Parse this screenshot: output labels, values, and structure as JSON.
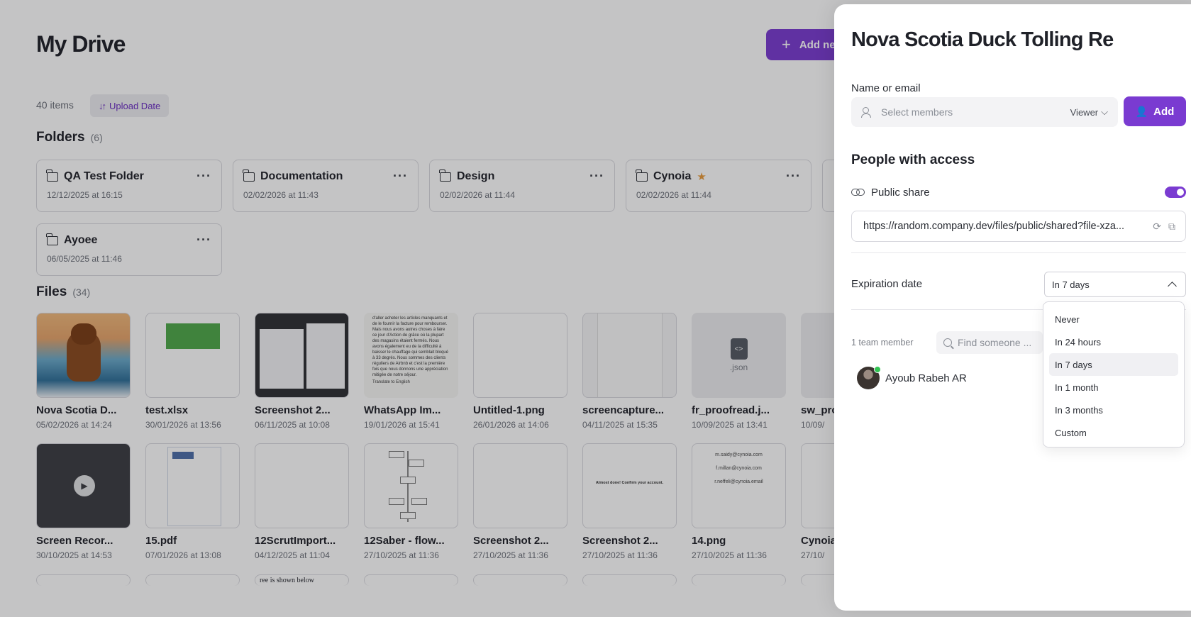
{
  "drive": {
    "title": "My Drive",
    "add_new_label": "Add ne",
    "items_count": "40 items",
    "sort_label": "Upload Date",
    "folders_title": "Folders",
    "folders_count": "(6)",
    "files_title": "Files",
    "files_count": "(34)",
    "folders": [
      {
        "name": "QA Test Folder",
        "date": "12/12/2025 at 16:15",
        "starred": false
      },
      {
        "name": "Documentation",
        "date": "02/02/2026 at 11:43",
        "starred": false
      },
      {
        "name": "Design",
        "date": "02/02/2026 at 11:44",
        "starred": false
      },
      {
        "name": "Cynoia",
        "date": "02/02/2026 at 11:44",
        "starred": true
      },
      {
        "name": "Ayoee",
        "date": "06/05/2025 at 11:46",
        "starred": false
      }
    ],
    "files_row1": [
      {
        "name": "Nova Scotia D...",
        "date": "05/02/2026 at 14:24"
      },
      {
        "name": "test.xlsx",
        "date": "30/01/2026 at 13:56"
      },
      {
        "name": "Screenshot 2...",
        "date": "06/11/2025 at 10:08"
      },
      {
        "name": "WhatsApp Im...",
        "date": "19/01/2026 at 15:41"
      },
      {
        "name": "Untitled-1.png",
        "date": "26/01/2026 at 14:06"
      },
      {
        "name": "screencapture...",
        "date": "04/11/2025 at 15:35"
      },
      {
        "name": "fr_proofread.j...",
        "date": "10/09/2025 at 13:41"
      },
      {
        "name": "sw_pro",
        "date": "10/09/"
      }
    ],
    "files_row2": [
      {
        "name": "Screen Recor...",
        "date": "30/10/2025 at 14:53"
      },
      {
        "name": "15.pdf",
        "date": "07/01/2026 at 13:08"
      },
      {
        "name": "12ScrutImport...",
        "date": "04/12/2025 at 11:04"
      },
      {
        "name": "12Saber - flow...",
        "date": "27/10/2025 at 11:36"
      },
      {
        "name": "Screenshot 2...",
        "date": "27/10/2025 at 11:36"
      },
      {
        "name": "Screenshot 2...",
        "date": "27/10/2025 at 11:36"
      },
      {
        "name": "14.png",
        "date": "27/10/2025 at 11:36"
      },
      {
        "name": "Cynoia",
        "date": "27/10/"
      }
    ],
    "json_label": ".json",
    "whatsapp_text": "d'aller acheter les articles manquants et de le fournir la facture pour rembourser. Mais nous avons autres choses à faire ce jour d'Action de grâce où la plupart des magasins étaient fermés. Nous avons également eu de la difficulté à baisser le chauffage qui semblait bloqué à 33 degrés. Nous sommes des clients réguliers de Airbnb et c'est la première fois que nous donnons une appréciation mitigée de notre séjour.",
    "whatsapp_footer": "Translate to English",
    "emails": [
      "m.saidy@cynoia.com",
      "f.millan@cynoia.com",
      "r.neffeli@cynoia.email"
    ],
    "confirm_text": "Almost done! Confirm your account.",
    "tree_text": "ree is shown below"
  },
  "share": {
    "title": "Nova Scotia Duck Tolling Re",
    "name_label": "Name or email",
    "members_placeholder": "Select members",
    "role": "Viewer",
    "add_label": "Add",
    "people_title": "People with access",
    "public_share_label": "Public share",
    "public_share_enabled": true,
    "url": "https://random.company.dev/files/public/shared?file-xza...",
    "expiration_label": "Expiration date",
    "expiration_value": "In 7 days",
    "expiration_options": [
      "Never",
      "In 24 hours",
      "In 7 days",
      "In 1 month",
      "In 3 months",
      "Custom"
    ],
    "team_label": "1 team member",
    "find_placeholder": "Find someone ...",
    "member_name": "Ayoub Rabeh AR"
  },
  "colors": {
    "accent": "#7a3bd1",
    "online": "#31c352",
    "star": "#e89a3a"
  }
}
